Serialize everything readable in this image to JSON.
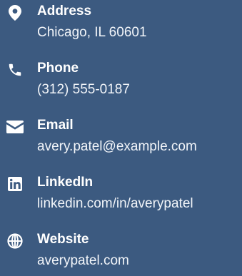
{
  "colors": {
    "background": "#3c5a80",
    "text": "#ffffff"
  },
  "contacts": [
    {
      "icon": "map-marker-icon",
      "label": "Address",
      "value": "Chicago, IL 60601"
    },
    {
      "icon": "phone-icon",
      "label": "Phone",
      "value": "(312) 555-0187"
    },
    {
      "icon": "envelope-icon",
      "label": "Email",
      "value": "avery.patel@example.com"
    },
    {
      "icon": "linkedin-icon",
      "label": "LinkedIn",
      "value": "linkedin.com/in/averypatel"
    },
    {
      "icon": "globe-icon",
      "label": "Website",
      "value": "averypatel.com"
    }
  ]
}
